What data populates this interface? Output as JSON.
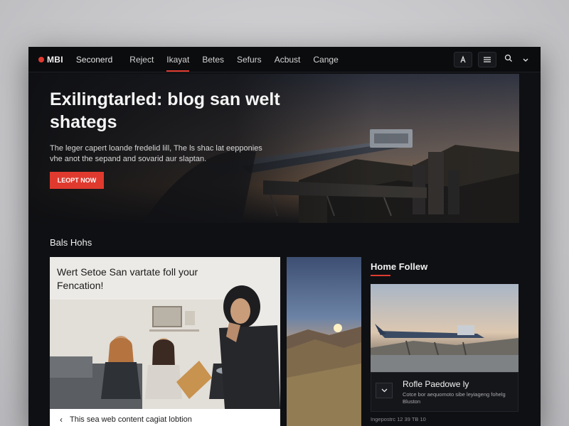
{
  "nav": {
    "logo": "MBI",
    "site_name": "Seconerd",
    "links": [
      "Reject",
      "Ikayat",
      "Betes",
      "Sefurs",
      "Acbust",
      "Cange"
    ],
    "active_index": 1
  },
  "hero": {
    "title": "Exilingtarled: blog san welt shategs",
    "description": "The leger capert loande fredelid lill, The ls shac lat eepponies vhe anot the sepand and sovarid aur slaptan.",
    "cta": "LEOPT NOW"
  },
  "section": {
    "heading": "Bals Hohs",
    "main_card": {
      "title": "Wert Setoe San vartate foll your Fencation!",
      "footer_arrow": "‹",
      "footer_text": "This sea web content cagiat lobtion"
    }
  },
  "sidebar": {
    "heading": "Home Follew",
    "card_title": "Rofle Paedowe ly",
    "card_text": "Cotce bor aequomoto sibe leyiageng fohelg Bluston",
    "meta": "Ingepostrc 12 39 TB 10"
  },
  "colors": {
    "accent": "#e03a2f",
    "page_bg": "#0f1013"
  }
}
